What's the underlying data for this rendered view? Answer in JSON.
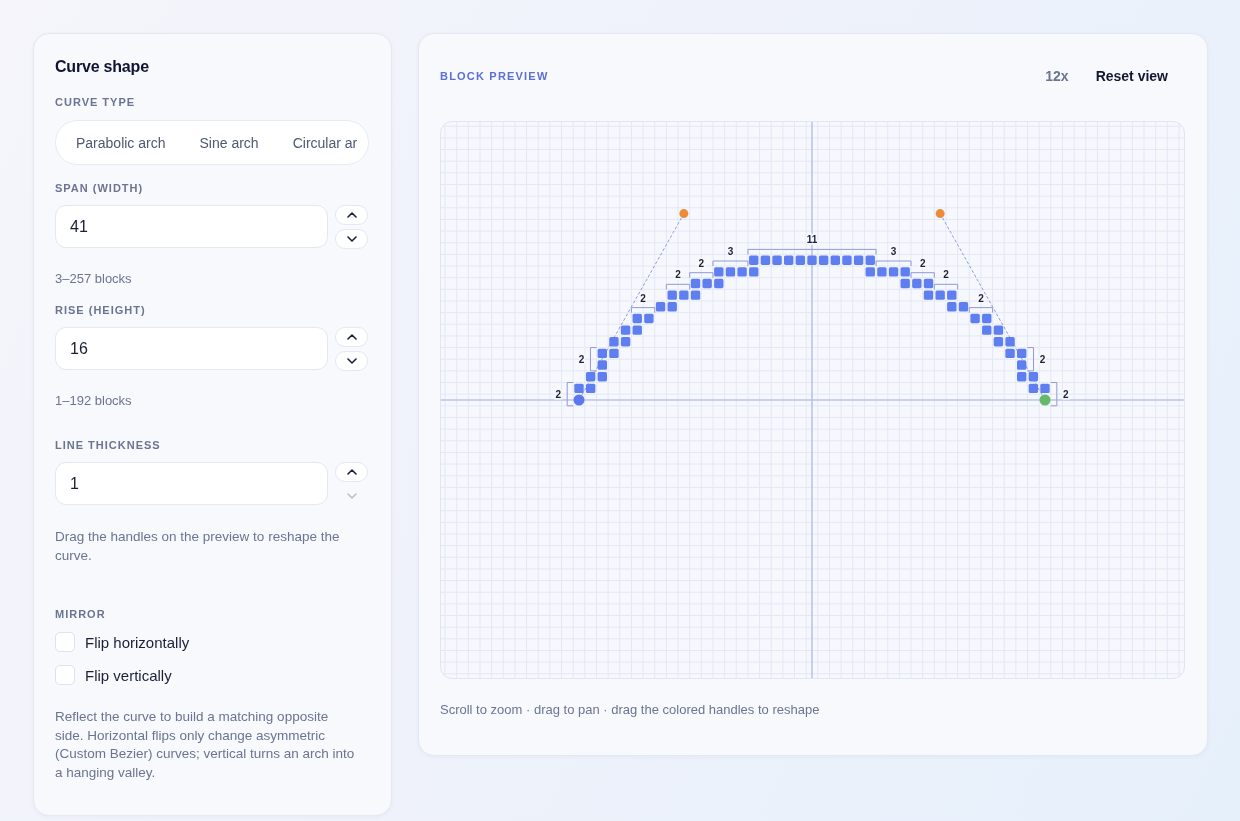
{
  "controls": {
    "title": "Curve shape",
    "curve_type": {
      "label": "CURVE TYPE",
      "options": [
        {
          "label": "Parabolic arch",
          "selected": false
        },
        {
          "label": "Sine arch",
          "selected": false
        },
        {
          "label": "Circular ar",
          "selected": false
        }
      ]
    },
    "fields": [
      {
        "label": "SPAN (WIDTH)",
        "value": "41",
        "hint": "3–257 blocks",
        "increment_disabled": false,
        "decrement_disabled": false
      },
      {
        "label": "RISE (HEIGHT)",
        "value": "16",
        "hint": "1–192 blocks",
        "increment_disabled": false,
        "decrement_disabled": false
      },
      {
        "label": "LINE THICKNESS",
        "value": "1",
        "increment_disabled": false,
        "decrement_disabled": true
      }
    ],
    "help_text": "Drag the handles on the preview to reshape the curve.",
    "mirror": {
      "label": "MIRROR",
      "options": [
        {
          "label": "Flip horizontally",
          "checked": false
        },
        {
          "label": "Flip vertically",
          "checked": false
        }
      ],
      "description": "Reflect the curve to build a matching opposite side. Horizontal flips only change asymmetric (Custom Bezier) curves; vertical turns an arch into a hanging valley."
    }
  },
  "preview": {
    "title": "BLOCK PREVIEW",
    "zoom": "12x",
    "reset_button": "Reset view",
    "dimension_labels": [
      "11",
      "3",
      "3",
      "2",
      "2",
      "2",
      "2",
      "2",
      "2",
      "2",
      "2",
      "2",
      "2"
    ],
    "hint": "Scroll to zoom · drag to pan · drag the colored handles to reshape"
  }
}
